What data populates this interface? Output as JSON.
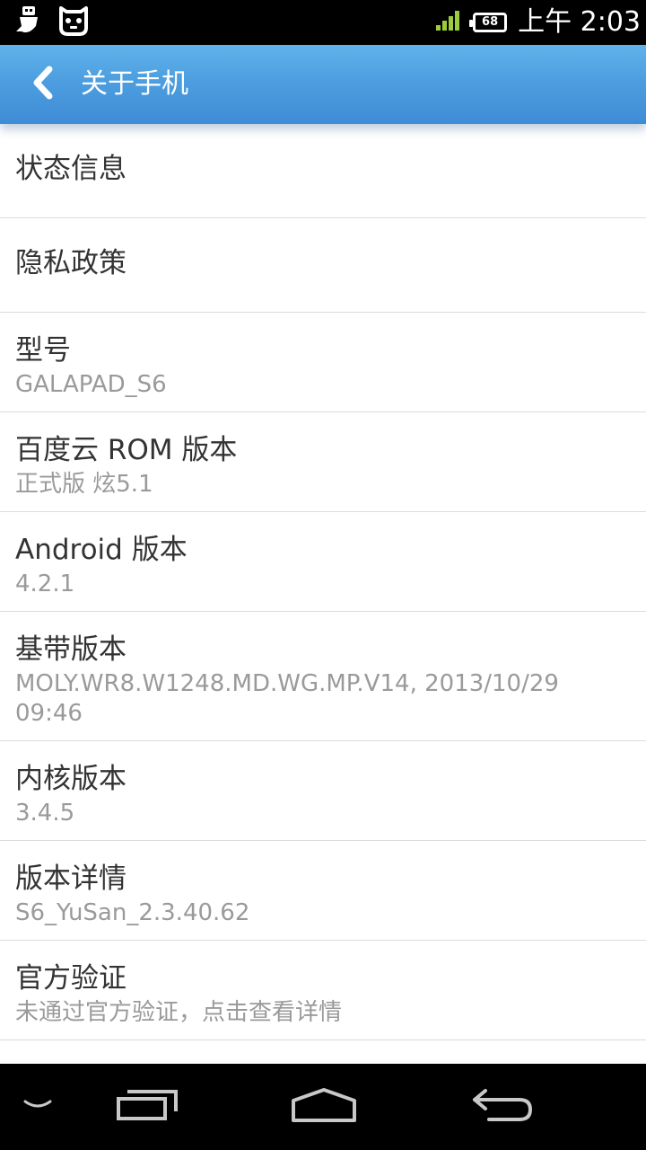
{
  "status_bar": {
    "time": "上午 2:03",
    "battery": "68",
    "icons": [
      "usb-icon",
      "android-bot-icon",
      "signal-icon",
      "battery-icon"
    ]
  },
  "action_bar": {
    "title": "关于手机",
    "back_icon": "chevron-left-icon",
    "color": "#4d9ee0"
  },
  "items": [
    {
      "title": "状态信息"
    },
    {
      "title": "隐私政策"
    },
    {
      "title": "型号",
      "summary": "GALAPAD_S6"
    },
    {
      "title": "百度云 ROM 版本",
      "summary": "正式版 炫5.1"
    },
    {
      "title": "Android 版本",
      "summary": "4.2.1"
    },
    {
      "title": "基带版本",
      "summary": "MOLY.WR8.W1248.MD.WG.MP.V14, 2013/10/29 09:46"
    },
    {
      "title": "内核版本",
      "summary": "3.4.5"
    },
    {
      "title": "版本详情",
      "summary": "S6_YuSan_2.3.40.62"
    },
    {
      "title": "官方验证",
      "summary": "未通过官方验证，点击查看详情"
    }
  ],
  "nav_bar": {
    "icons": [
      "menu-hide-icon",
      "recent-apps-icon",
      "home-icon",
      "back-icon"
    ]
  }
}
